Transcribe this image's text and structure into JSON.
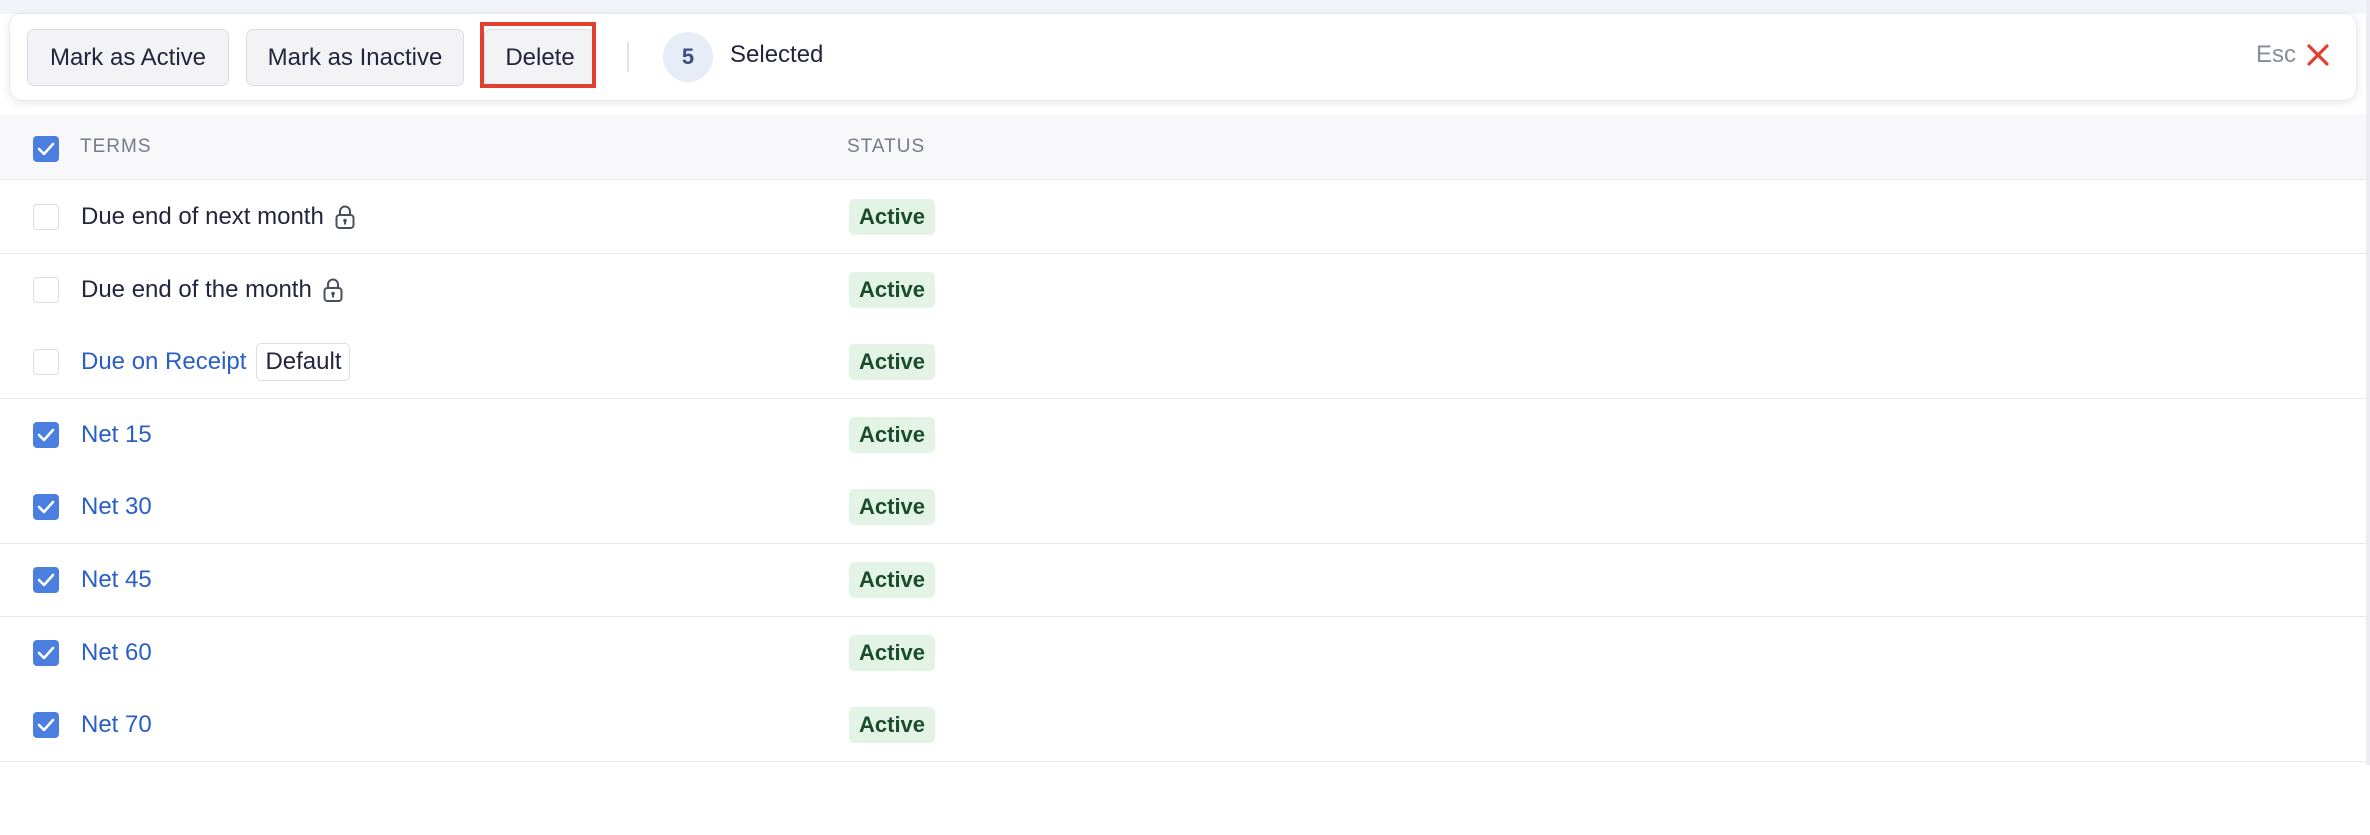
{
  "action_bar": {
    "mark_active_label": "Mark as Active",
    "mark_inactive_label": "Mark as Inactive",
    "delete_label": "Delete",
    "selected_count": "5",
    "selected_label": "Selected",
    "esc_label": "Esc"
  },
  "table": {
    "header": {
      "terms": "TERMS",
      "status": "STATUS",
      "select_all_checked": true
    },
    "rows": [
      {
        "term": "Due end of next month",
        "locked": true,
        "is_link": false,
        "tag": "",
        "status": "Active",
        "checked": false
      },
      {
        "term": "Due end of the month",
        "locked": true,
        "is_link": false,
        "tag": "",
        "status": "Active",
        "checked": false
      },
      {
        "term": "Due on Receipt",
        "locked": false,
        "is_link": true,
        "tag": "Default",
        "status": "Active",
        "checked": false
      },
      {
        "term": "Net 15",
        "locked": false,
        "is_link": true,
        "tag": "",
        "status": "Active",
        "checked": true
      },
      {
        "term": "Net 30",
        "locked": false,
        "is_link": true,
        "tag": "",
        "status": "Active",
        "checked": true
      },
      {
        "term": "Net 45",
        "locked": false,
        "is_link": true,
        "tag": "",
        "status": "Active",
        "checked": true
      },
      {
        "term": "Net 60",
        "locked": false,
        "is_link": true,
        "tag": "",
        "status": "Active",
        "checked": true
      },
      {
        "term": "Net 70",
        "locked": false,
        "is_link": true,
        "tag": "",
        "status": "Active",
        "checked": true
      }
    ]
  },
  "colors": {
    "accent": "#4a7fe0",
    "link": "#2a5fc7",
    "status_bg": "#e3f4e7",
    "status_text": "#1b4c2c",
    "highlight": "#e04030",
    "close": "#e04030"
  },
  "icons": {
    "lock": "lock-icon",
    "close": "close-icon",
    "checkmark": "checkmark-icon"
  }
}
